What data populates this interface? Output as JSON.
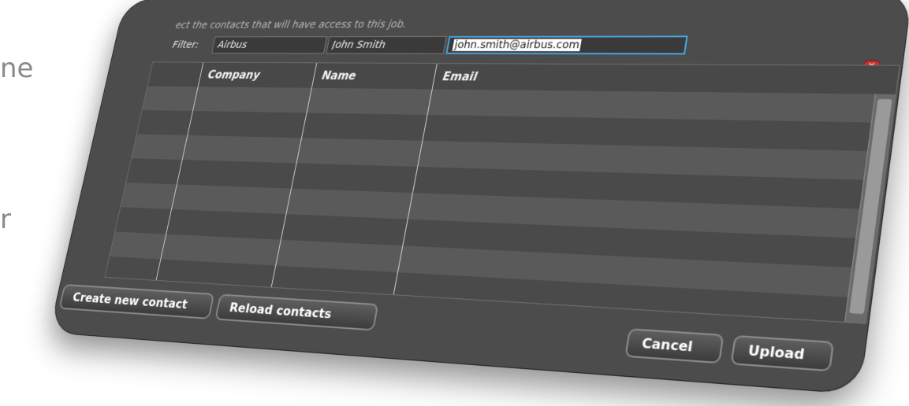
{
  "background": {
    "text_line_1": "ne",
    "text_line_2": "r"
  },
  "dialog": {
    "instructions": "ect the contacts that will have access to this job.",
    "filter": {
      "label": "Filter:",
      "company_value": "Airbus",
      "name_value": "John Smith",
      "email_value": "john.smith@airbus.com"
    },
    "close_icon": "close-icon",
    "table": {
      "headers": [
        "Company",
        "Name",
        "Email"
      ],
      "rows": [
        [
          "",
          "",
          ""
        ],
        [
          "",
          "",
          ""
        ],
        [
          "",
          "",
          ""
        ],
        [
          "",
          "",
          ""
        ],
        [
          "",
          "",
          ""
        ],
        [
          "",
          "",
          ""
        ],
        [
          "",
          "",
          ""
        ],
        [
          "",
          "",
          ""
        ]
      ]
    },
    "buttons": {
      "create_contact": "Create new contact",
      "reload_contacts": "Reload contacts",
      "cancel": "Cancel",
      "upload": "Upload"
    }
  },
  "colors": {
    "dialog_bg": "#4c4c4c",
    "selection_border": "#4aa3e0",
    "close_red": "#c9302c"
  }
}
